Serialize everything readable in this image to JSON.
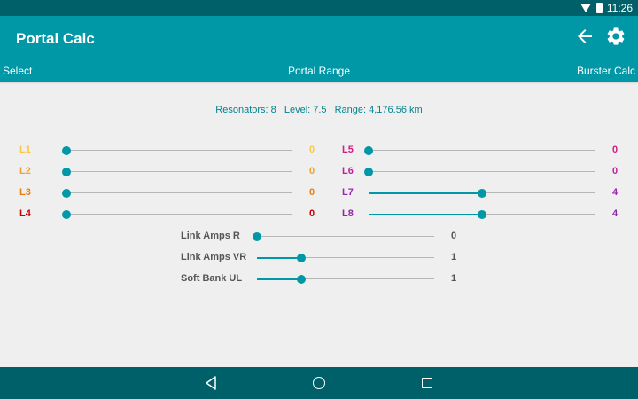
{
  "status_bar": {
    "time": "11:26"
  },
  "app_bar": {
    "title": "Portal Calc"
  },
  "tabs": {
    "left": "Select",
    "center": "Portal Range",
    "right": "Burster Calc"
  },
  "summary": {
    "resonators": "Resonators: 8",
    "level": "Level: 7.5",
    "range": "Range: 4,176.56 km"
  },
  "colors": {
    "accent": "#0097a7",
    "dark_accent": "#00606a",
    "L1": "#f7c948",
    "L2": "#f0a030",
    "L3": "#ea7b10",
    "L4": "#d00000",
    "L5": "#d02080",
    "L6": "#c020a0",
    "L7": "#9c27b0",
    "L8": "#8e24aa",
    "mod": "#555555"
  },
  "resonators": [
    {
      "label": "L1",
      "value": "0",
      "level": 0,
      "max": 8
    },
    {
      "label": "L2",
      "value": "0",
      "level": 0,
      "max": 8
    },
    {
      "label": "L3",
      "value": "0",
      "level": 0,
      "max": 8
    },
    {
      "label": "L4",
      "value": "0",
      "level": 0,
      "max": 8
    },
    {
      "label": "L5",
      "value": "0",
      "level": 0,
      "max": 8
    },
    {
      "label": "L6",
      "value": "0",
      "level": 0,
      "max": 8
    },
    {
      "label": "L7",
      "value": "4",
      "level": 4,
      "max": 8
    },
    {
      "label": "L8",
      "value": "4",
      "level": 4,
      "max": 8
    }
  ],
  "mods": [
    {
      "label": "Link Amps R",
      "value": "0",
      "level": 0,
      "max": 4
    },
    {
      "label": "Link Amps VR",
      "value": "1",
      "level": 1,
      "max": 4
    },
    {
      "label": "Soft Bank UL",
      "value": "1",
      "level": 1,
      "max": 4
    }
  ]
}
